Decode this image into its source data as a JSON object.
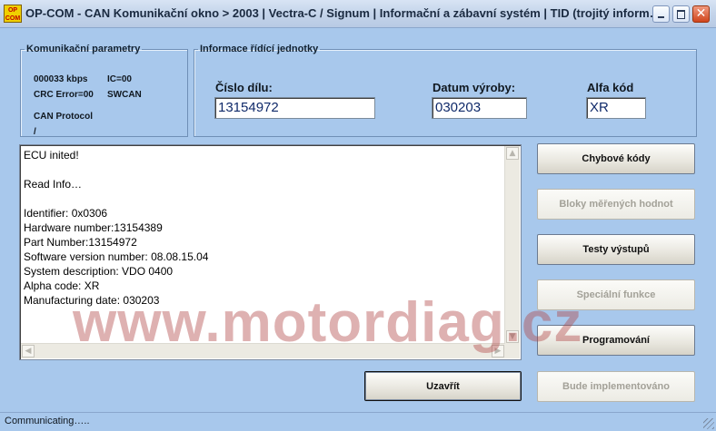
{
  "window": {
    "title": "OP-COM - CAN Komunikační okno > 2003 | Vectra-C / Signum | Informační a zábavní systém | TID (trojitý inform…",
    "icon_label_top": "OP",
    "icon_label_bottom": "COM",
    "close_glyph": "✕"
  },
  "comm_params": {
    "legend": "Komunikační parametry",
    "speed": "000033 kbps",
    "ic": "IC=00",
    "crc": "CRC Error=00",
    "bus": "SWCAN",
    "protocol_label": "CAN Protocol",
    "protocol_value": "/"
  },
  "ecu_info": {
    "legend": "Informace řídící jednotky",
    "part_label": "Číslo dílu:",
    "part_value": "13154972",
    "date_label": "Datum výroby:",
    "date_value": "030203",
    "alpha_label": "Alfa kód",
    "alpha_value": "XR"
  },
  "log": {
    "lines": [
      "ECU inited!",
      "",
      "Read Info…",
      "",
      "Identifier: 0x0306",
      "Hardware number:13154389",
      "Part Number:13154972",
      "Software version number: 08.08.15.04",
      "System description: VDO  0400",
      "Alpha code: XR",
      "Manufacturing date: 030203"
    ]
  },
  "buttons": {
    "error_codes": "Chybové kódy",
    "measured_blocks": "Bloky měřených hodnot",
    "output_tests": "Testy výstupů",
    "special_functions": "Speciální funkce",
    "programming": "Programování",
    "future": "Bude implementováno",
    "close": "Uzavřít"
  },
  "watermark": "www.motordiag.cz",
  "status": {
    "text": "Communicating….."
  }
}
